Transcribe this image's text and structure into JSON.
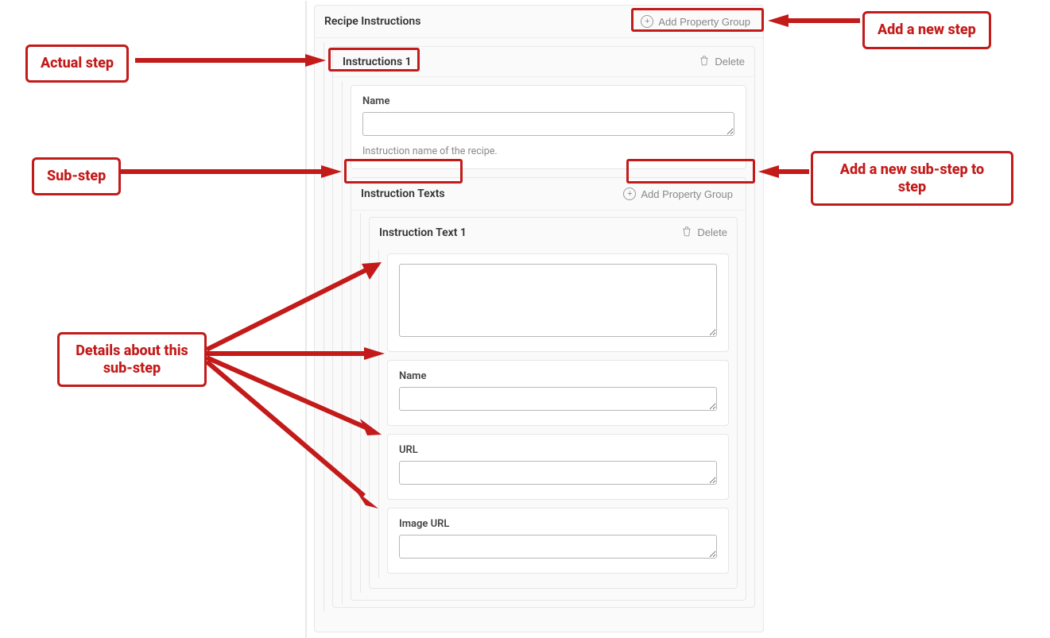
{
  "main": {
    "title": "Recipe Instructions",
    "add_label": "Add Property Group",
    "instruction": {
      "title": "Instructions 1",
      "delete_label": "Delete",
      "name_field": {
        "label": "Name",
        "value": "",
        "help": "Instruction name of the recipe."
      },
      "texts": {
        "title": "Instruction Texts",
        "add_label": "Add Property Group",
        "item": {
          "title": "Instruction Text 1",
          "delete_label": "Delete",
          "big_text": "",
          "name_field": {
            "label": "Name",
            "value": ""
          },
          "url_field": {
            "label": "URL",
            "value": ""
          },
          "image_url_field": {
            "label": "Image URL",
            "value": ""
          }
        }
      }
    }
  },
  "annotations": {
    "actual_step": "Actual step",
    "add_new_step": "Add a new step",
    "sub_step": "Sub-step",
    "add_new_substep": "Add a new sub-step to step",
    "details": "Details about this sub-step"
  }
}
